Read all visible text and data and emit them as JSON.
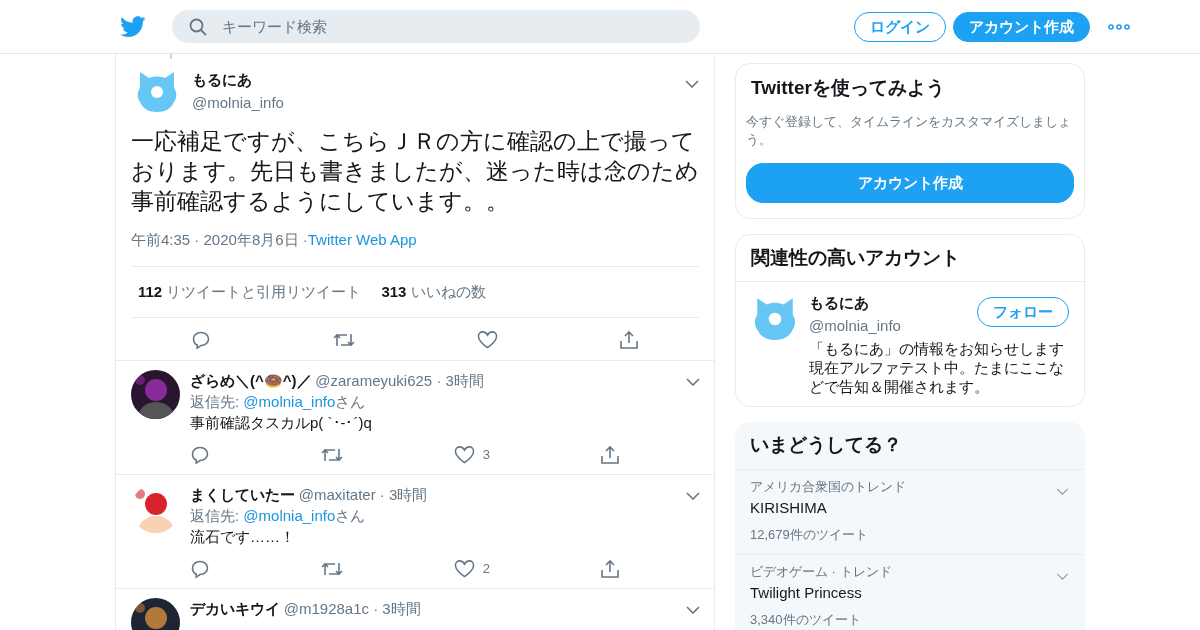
{
  "header": {
    "search": {
      "placeholder": "キーワード検索"
    },
    "buttons": [
      {
        "label": "ログイン",
        "kind": "outline"
      },
      {
        "label": "アカウント作成",
        "kind": "solid"
      }
    ]
  },
  "tweet": {
    "name": "もるにあ",
    "handle": "@molnia_info",
    "text": "一応補足ですが、こちらＪＲの方に確認の上で撮っております。先日も書きましたが、迷った時は念のため事前確認するようにしています。。",
    "time": "午前4:35 ·",
    "date": "2020年8月6日 ·",
    "source": "Twitter Web App",
    "stats": [
      {
        "count": "112",
        "label": "リツイートと引用リツイート"
      },
      {
        "count": "313",
        "label": "いいねの数"
      }
    ]
  },
  "replies": [
    {
      "name": "ざらめ＼(^🍩^)／",
      "handle": "@zarameyuki625",
      "time": "· 3時間",
      "reply_prefix": "返信先: ",
      "reply_to": "@molnia_info",
      "reply_suffix": "さん",
      "text": "事前確認タスカルp( `･-･´)q",
      "likes": "3",
      "kind": "picture"
    },
    {
      "name": "まくしていたー",
      "handle": "@maxitater",
      "time": "· 3時間",
      "reply_prefix": "返信先: ",
      "reply_to": "@molnia_info",
      "reply_suffix": "さん",
      "text": "流石です……！",
      "likes": "2",
      "kind": "picture"
    },
    {
      "name": "デカいキウイ",
      "handle": "@m1928a1c",
      "time": "· 3時間",
      "kind": "picture"
    }
  ],
  "signup_card": {
    "title": "Twitterを使ってみよう",
    "text": "今すぐ登録して、タイムラインをカスタマイズしましょう。",
    "button": "アカウント作成"
  },
  "related": {
    "title": "関連性の高いアカウント",
    "accounts": [
      {
        "name": "もるにあ",
        "handle": "@molnia_info",
        "button": "フォロー",
        "bio": "「もるにあ」の情報をお知らせします現在アルファテスト中。たまにここなどで告知＆開催されます。"
      }
    ]
  },
  "trends": {
    "title": "いまどうしてる？",
    "items": [
      {
        "context": "アメリカ合衆国のトレンド",
        "topic": "KIRISHIMA",
        "count": "12,679件のツイート"
      },
      {
        "context": "ビデオゲーム · トレンド",
        "topic": "Twilight Princess",
        "count": "3,340件のツイート"
      }
    ]
  }
}
